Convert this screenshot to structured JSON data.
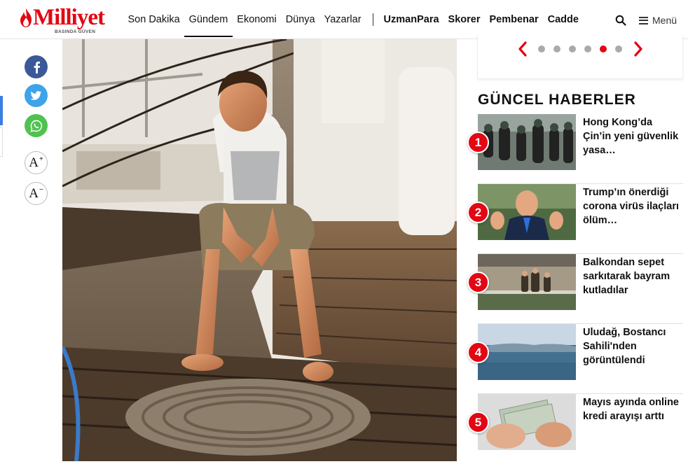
{
  "header": {
    "logo_text": "Milliyet",
    "logo_tagline": "BASINDA GÜVEN",
    "nav_primary": [
      "Son Dakika",
      "Gündem",
      "Ekonomi",
      "Dünya",
      "Yazarlar"
    ],
    "nav_secondary": [
      "UzmanPara",
      "Skorer",
      "Pembenar",
      "Cadde"
    ],
    "active_nav": "Gündem",
    "menu_label": "Menü"
  },
  "social": {
    "font_increase_label": "A",
    "font_decrease_label": "A",
    "increase_symbol": "+",
    "decrease_symbol": "−"
  },
  "sidebar": {
    "slider": {
      "dot_count": 6,
      "active_index": 4
    },
    "section_title": "GÜNCEL HABERLER",
    "news": [
      {
        "rank": "1",
        "title": "Hong Kong’da Çin’in yeni güvenlik yasa…"
      },
      {
        "rank": "2",
        "title": "Trump’ın önerdiği corona virüs ilaçları ölüm…"
      },
      {
        "rank": "3",
        "title": "Balkondan sepet sarkıtarak bayram kutladılar"
      },
      {
        "rank": "4",
        "title": "Uludağ, Bostancı Sahili'nden görüntülendi"
      },
      {
        "rank": "5",
        "title": "Mayıs ayında online kredi arayışı arttı"
      }
    ]
  },
  "colors": {
    "brand_red": "#e30613",
    "facebook": "#3b5998",
    "twitter": "#3ea3e8",
    "whatsapp": "#4fc24f"
  }
}
